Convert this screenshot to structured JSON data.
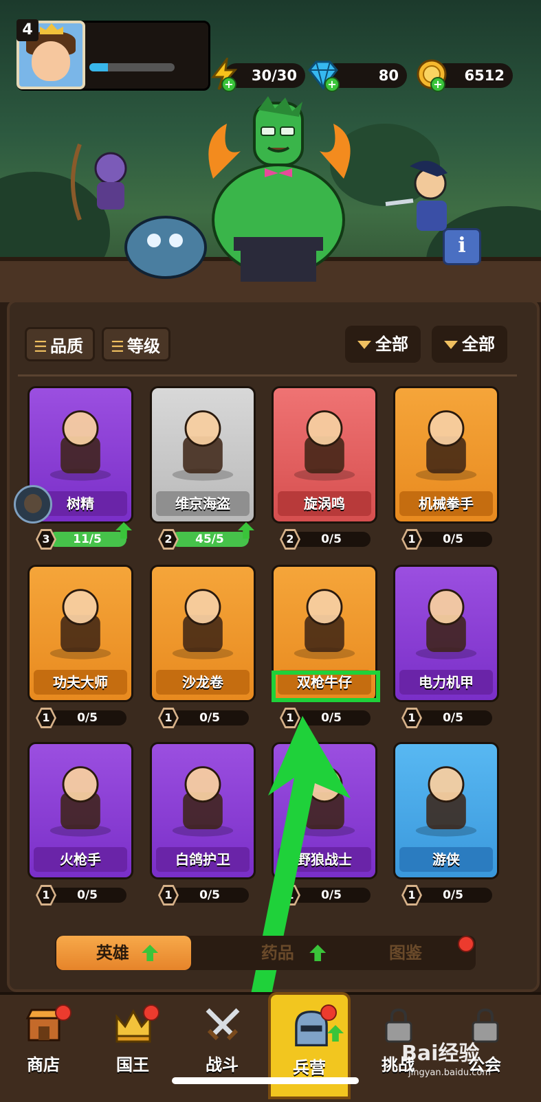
{
  "player": {
    "level": "4",
    "xp_fraction": 0.22
  },
  "resources": {
    "energy": "30/30",
    "gems": "80",
    "gold": "6512"
  },
  "filters": {
    "quality_label": "品质",
    "level_label": "等级",
    "dropdown1": "全部",
    "dropdown2": "全部"
  },
  "heroes": [
    {
      "name": "树精",
      "level": "3",
      "shards": "11/5",
      "progress": 1.0,
      "upgradable": true,
      "quality": "purple"
    },
    {
      "name": "维京海盗",
      "level": "2",
      "shards": "45/5",
      "progress": 1.0,
      "upgradable": true,
      "quality": "gray"
    },
    {
      "name": "旋涡鸣",
      "level": "2",
      "shards": "0/5",
      "progress": 0,
      "upgradable": false,
      "quality": "red"
    },
    {
      "name": "机械拳手",
      "level": "1",
      "shards": "0/5",
      "progress": 0,
      "upgradable": false,
      "quality": "orange"
    },
    {
      "name": "功夫大师",
      "level": "1",
      "shards": "0/5",
      "progress": 0,
      "upgradable": false,
      "quality": "orange"
    },
    {
      "name": "沙龙卷",
      "level": "1",
      "shards": "0/5",
      "progress": 0,
      "upgradable": false,
      "quality": "orange"
    },
    {
      "name": "双枪牛仔",
      "level": "1",
      "shards": "0/5",
      "progress": 0,
      "upgradable": false,
      "quality": "orange"
    },
    {
      "name": "电力机甲",
      "level": "1",
      "shards": "0/5",
      "progress": 0,
      "upgradable": false,
      "quality": "purple"
    },
    {
      "name": "火枪手",
      "level": "1",
      "shards": "0/5",
      "progress": 0,
      "upgradable": false,
      "quality": "purple"
    },
    {
      "name": "白鸽护卫",
      "level": "1",
      "shards": "0/5",
      "progress": 0,
      "upgradable": false,
      "quality": "purple"
    },
    {
      "name": "野狼战士",
      "level": "1",
      "shards": "0/5",
      "progress": 0,
      "upgradable": false,
      "quality": "purple"
    },
    {
      "name": "游侠",
      "level": "1",
      "shards": "0/5",
      "progress": 0,
      "upgradable": false,
      "quality": "blue"
    }
  ],
  "subtabs": {
    "heroes": "英雄",
    "items": "药品",
    "codex": "图鉴"
  },
  "nav": {
    "shop": "商店",
    "king": "国王",
    "battle": "战斗",
    "barracks": "兵营",
    "challenge": "挑战",
    "guild": "公会"
  },
  "watermark": {
    "main": "Bai经验",
    "sub": "jingyan.baidu.com"
  },
  "colors": {
    "highlight": "#1fd13a",
    "arrow": "#1fd13a",
    "accent": "#f2c61f"
  },
  "icons": [
    "energy-icon",
    "gem-icon",
    "gold-icon",
    "info-icon",
    "shop-icon",
    "crown-icon",
    "swords-icon",
    "knight-helmet-icon",
    "lock-icon"
  ]
}
